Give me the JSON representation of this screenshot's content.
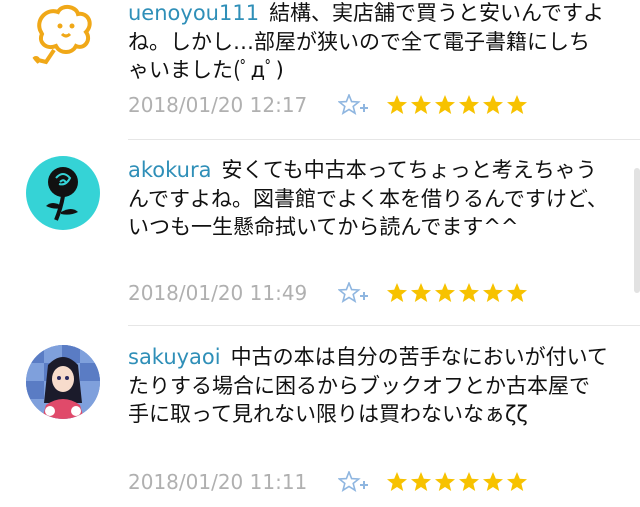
{
  "comments": [
    {
      "username": "uenoyou111",
      "text": "結構、実店舗で買うと安いんですよね。しかし…部屋が狭いので全て電子書籍にしちゃいました(ﾟдﾟ)",
      "timestamp": "2018/01/20 12:17",
      "avatar": "rooster-icon",
      "stars": 6,
      "accent": "#f5a623"
    },
    {
      "username": "akokura",
      "text": "安くても中古本ってちょっと考えちゃうんですよね。図書館でよく本を借りるんですけど、いつも一生懸命拭いてから読んでます^^",
      "timestamp": "2018/01/20 11:49",
      "avatar": "rose-icon",
      "stars": 6,
      "accent": "#35d3d6"
    },
    {
      "username": "sakuyaoi",
      "text": "中古の本は自分の苦手なにおいが付いてたりする場合に困るからブックオフとか古本屋で手に取って見れない限りは買わないなぁζζ",
      "timestamp": "2018/01/20 11:11",
      "avatar": "anime-girl-avatar",
      "stars": 6,
      "accent": "#2e6fc2"
    }
  ],
  "colors": {
    "username": "#2f8fb8",
    "timestamp": "#b0b0b0",
    "star": "#f7c200",
    "fav_icon": "#8fb6e0",
    "divider": "#e6e6e6"
  }
}
